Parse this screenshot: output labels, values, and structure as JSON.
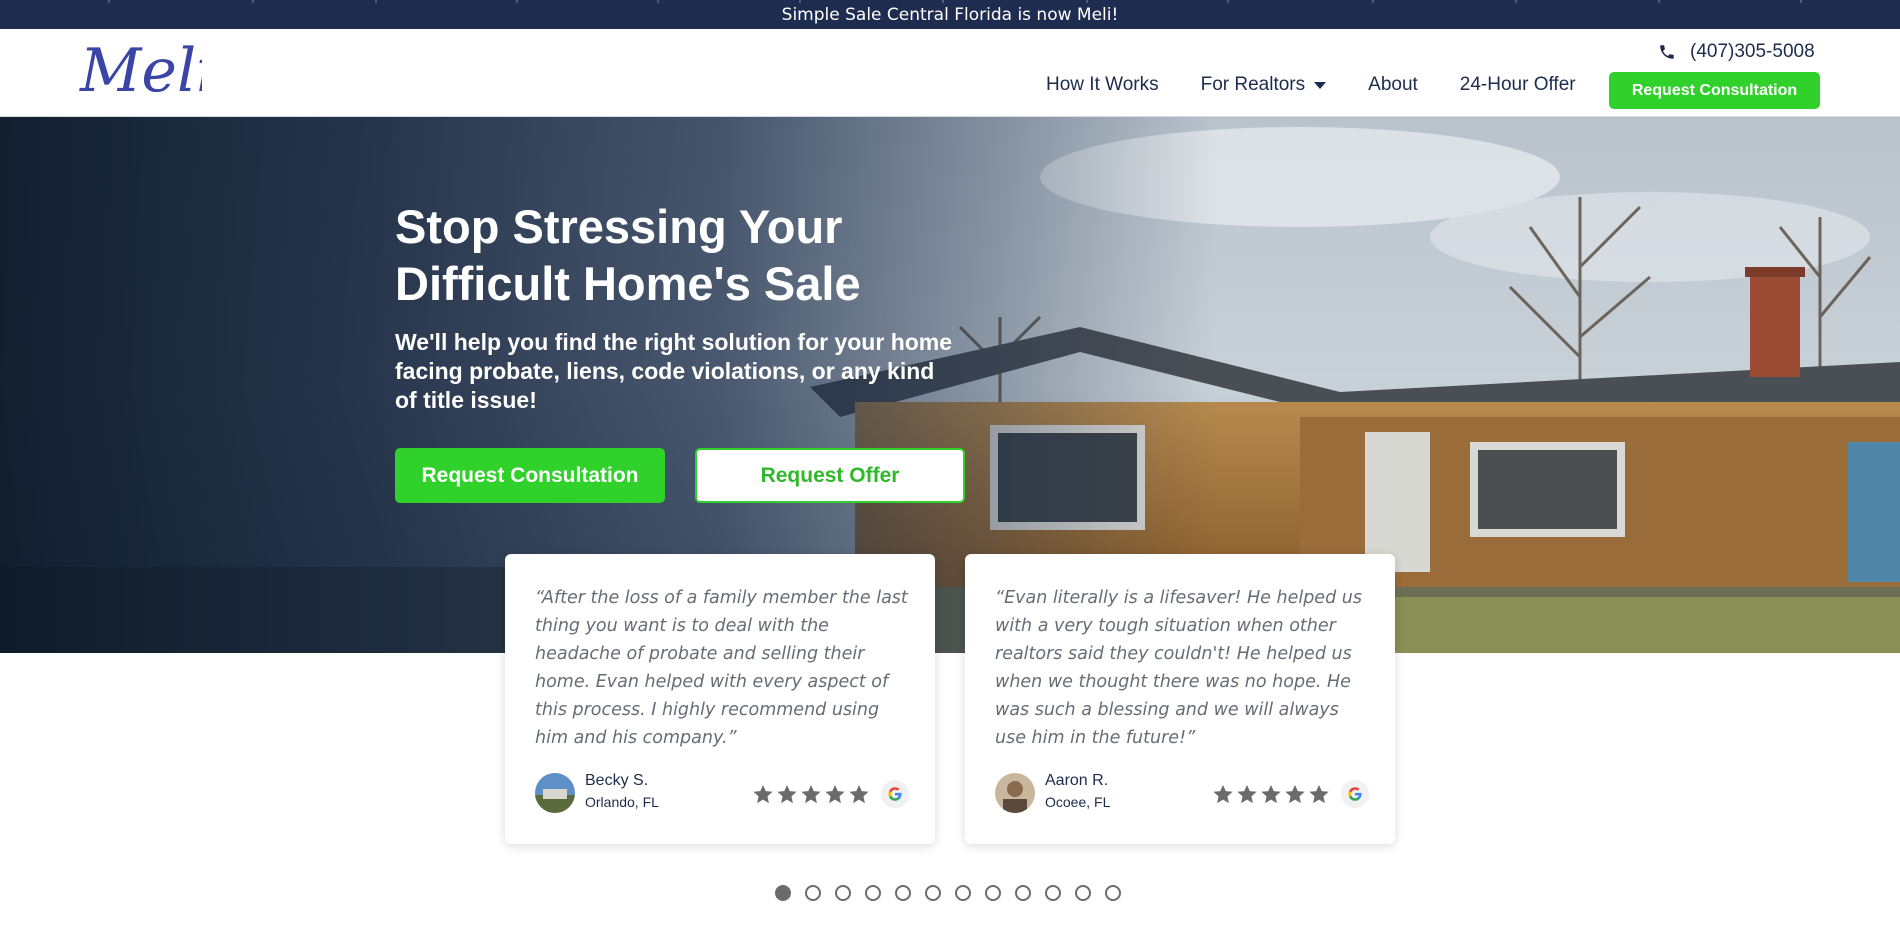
{
  "announcement": {
    "text": "Simple Sale Central Florida is now Meli!"
  },
  "header": {
    "logo_text": "Meli",
    "phone": "(407)305-5008",
    "phone_icon": "phone-icon",
    "nav": [
      {
        "label": "How It Works",
        "has_dropdown": false
      },
      {
        "label": "For Realtors",
        "has_dropdown": true
      },
      {
        "label": "About",
        "has_dropdown": false
      },
      {
        "label": "24-Hour Offer",
        "has_dropdown": false
      }
    ],
    "cta_label": "Request Consultation"
  },
  "hero": {
    "title_line1": "Stop Stressing Your",
    "title_line2": "Difficult Home's Sale",
    "subtitle": "We'll help you find the right solution for your home facing probate, liens, code violations, or any kind of title issue!",
    "primary_button": "Request Consultation",
    "secondary_button": "Request Offer"
  },
  "reviews": [
    {
      "quote": "“After the loss of a family member the last thing you want is to deal with the headache of probate and selling their home. Evan helped with every aspect of this process. I highly recommend using him and his company.”",
      "name": "Becky S.",
      "location": "Orlando, FL",
      "rating": 5,
      "source_icon": "google-icon"
    },
    {
      "quote": "“Evan literally is a lifesaver! He helped us with a very tough situation when other realtors said they couldn't! He helped us when we thought there was no hope. He was such a blessing and we will always use him in the future!”",
      "name": "Aaron R.",
      "location": "Ocoee, FL",
      "rating": 5,
      "source_icon": "google-icon"
    }
  ],
  "carousel": {
    "total_slides": 12,
    "active_index": 0
  },
  "colors": {
    "brand_navy": "#1d2c4f",
    "cta_green": "#2fd12a",
    "logo_blue": "#3a45a6",
    "star_gray": "#6b6b6b"
  }
}
